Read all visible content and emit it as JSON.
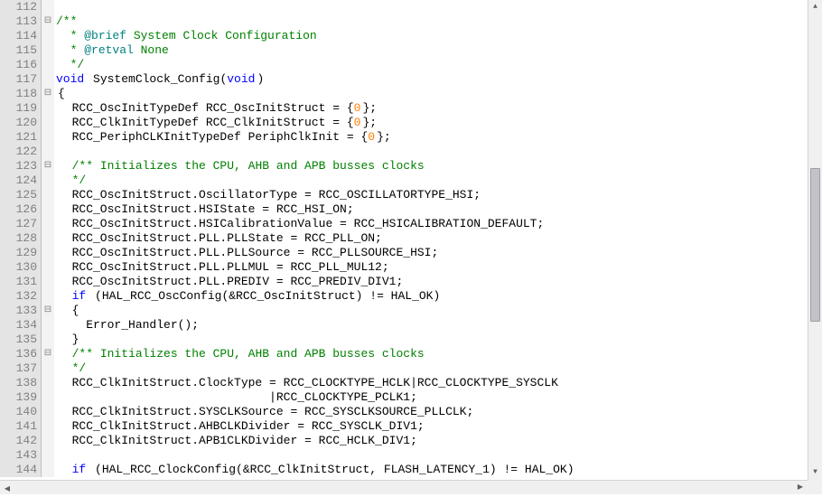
{
  "scroll": {
    "up": "▲",
    "down": "▼",
    "left": "◀",
    "right": "▶"
  },
  "lines": [
    {
      "n": "112",
      "fold": "",
      "seg": [
        {
          "c": "code",
          "t": ""
        }
      ]
    },
    {
      "n": "113",
      "fold": "⊟",
      "seg": [
        {
          "c": "doc",
          "t": "/**"
        }
      ]
    },
    {
      "n": "114",
      "fold": "",
      "seg": [
        {
          "c": "doc",
          "t": "  * "
        },
        {
          "c": "doctag",
          "t": "@brief"
        },
        {
          "c": "doc",
          "t": " System Clock Configuration"
        }
      ]
    },
    {
      "n": "115",
      "fold": "",
      "seg": [
        {
          "c": "doc",
          "t": "  * "
        },
        {
          "c": "doctag",
          "t": "@retval"
        },
        {
          "c": "doc",
          "t": " None"
        }
      ]
    },
    {
      "n": "116",
      "fold": "",
      "seg": [
        {
          "c": "doc",
          "t": "  */"
        }
      ]
    },
    {
      "n": "117",
      "fold": "",
      "seg": [
        {
          "c": "kw",
          "t": "void"
        },
        {
          "c": "code",
          "t": " SystemClock_Config("
        },
        {
          "c": "kw",
          "t": "void"
        },
        {
          "c": "code",
          "t": ")"
        }
      ]
    },
    {
      "n": "118",
      "fold": "⊟",
      "seg": [
        {
          "c": "code",
          "t": "{"
        }
      ]
    },
    {
      "n": "119",
      "fold": "",
      "seg": [
        {
          "c": "code",
          "t": "  RCC_OscInitTypeDef RCC_OscInitStruct = {"
        },
        {
          "c": "num",
          "t": "0"
        },
        {
          "c": "code",
          "t": "};"
        }
      ]
    },
    {
      "n": "120",
      "fold": "",
      "seg": [
        {
          "c": "code",
          "t": "  RCC_ClkInitTypeDef RCC_ClkInitStruct = {"
        },
        {
          "c": "num",
          "t": "0"
        },
        {
          "c": "code",
          "t": "};"
        }
      ]
    },
    {
      "n": "121",
      "fold": "",
      "seg": [
        {
          "c": "code",
          "t": "  RCC_PeriphCLKInitTypeDef PeriphClkInit = {"
        },
        {
          "c": "num",
          "t": "0"
        },
        {
          "c": "code",
          "t": "};"
        }
      ]
    },
    {
      "n": "122",
      "fold": "",
      "seg": [
        {
          "c": "code",
          "t": ""
        }
      ]
    },
    {
      "n": "123",
      "fold": "⊟",
      "seg": [
        {
          "c": "code",
          "t": "  "
        },
        {
          "c": "doc",
          "t": "/** Initializes the CPU, AHB and APB busses clocks"
        }
      ]
    },
    {
      "n": "124",
      "fold": "",
      "seg": [
        {
          "c": "code",
          "t": "  "
        },
        {
          "c": "doc",
          "t": "*/"
        }
      ]
    },
    {
      "n": "125",
      "fold": "",
      "seg": [
        {
          "c": "code",
          "t": "  RCC_OscInitStruct.OscillatorType = RCC_OSCILLATORTYPE_HSI;"
        }
      ]
    },
    {
      "n": "126",
      "fold": "",
      "seg": [
        {
          "c": "code",
          "t": "  RCC_OscInitStruct.HSIState = RCC_HSI_ON;"
        }
      ]
    },
    {
      "n": "127",
      "fold": "",
      "seg": [
        {
          "c": "code",
          "t": "  RCC_OscInitStruct.HSICalibrationValue = RCC_HSICALIBRATION_DEFAULT;"
        }
      ]
    },
    {
      "n": "128",
      "fold": "",
      "seg": [
        {
          "c": "code",
          "t": "  RCC_OscInitStruct.PLL.PLLState = RCC_PLL_ON;"
        }
      ]
    },
    {
      "n": "129",
      "fold": "",
      "seg": [
        {
          "c": "code",
          "t": "  RCC_OscInitStruct.PLL.PLLSource = RCC_PLLSOURCE_HSI;"
        }
      ]
    },
    {
      "n": "130",
      "fold": "",
      "seg": [
        {
          "c": "code",
          "t": "  RCC_OscInitStruct.PLL.PLLMUL = RCC_PLL_MUL12;"
        }
      ]
    },
    {
      "n": "131",
      "fold": "",
      "seg": [
        {
          "c": "code",
          "t": "  RCC_OscInitStruct.PLL.PREDIV = RCC_PREDIV_DIV1;"
        }
      ]
    },
    {
      "n": "132",
      "fold": "",
      "seg": [
        {
          "c": "code",
          "t": "  "
        },
        {
          "c": "kw",
          "t": "if"
        },
        {
          "c": "code",
          "t": " (HAL_RCC_OscConfig(&RCC_OscInitStruct) != HAL_OK)"
        }
      ]
    },
    {
      "n": "133",
      "fold": "⊟",
      "seg": [
        {
          "c": "code",
          "t": "  {"
        }
      ]
    },
    {
      "n": "134",
      "fold": "",
      "seg": [
        {
          "c": "code",
          "t": "    Error_Handler();"
        }
      ]
    },
    {
      "n": "135",
      "fold": "",
      "seg": [
        {
          "c": "code",
          "t": "  }"
        }
      ]
    },
    {
      "n": "136",
      "fold": "⊟",
      "seg": [
        {
          "c": "code",
          "t": "  "
        },
        {
          "c": "doc",
          "t": "/** Initializes the CPU, AHB and APB busses clocks"
        }
      ]
    },
    {
      "n": "137",
      "fold": "",
      "seg": [
        {
          "c": "code",
          "t": "  "
        },
        {
          "c": "doc",
          "t": "*/"
        }
      ]
    },
    {
      "n": "138",
      "fold": "",
      "seg": [
        {
          "c": "code",
          "t": "  RCC_ClkInitStruct.ClockType = RCC_CLOCKTYPE_HCLK|RCC_CLOCKTYPE_SYSCLK"
        }
      ]
    },
    {
      "n": "139",
      "fold": "",
      "seg": [
        {
          "c": "code",
          "t": "                              |RCC_CLOCKTYPE_PCLK1;"
        }
      ]
    },
    {
      "n": "140",
      "fold": "",
      "seg": [
        {
          "c": "code",
          "t": "  RCC_ClkInitStruct.SYSCLKSource = RCC_SYSCLKSOURCE_PLLCLK;"
        }
      ]
    },
    {
      "n": "141",
      "fold": "",
      "seg": [
        {
          "c": "code",
          "t": "  RCC_ClkInitStruct.AHBCLKDivider = RCC_SYSCLK_DIV1;"
        }
      ]
    },
    {
      "n": "142",
      "fold": "",
      "seg": [
        {
          "c": "code",
          "t": "  RCC_ClkInitStruct.APB1CLKDivider = RCC_HCLK_DIV1;"
        }
      ]
    },
    {
      "n": "143",
      "fold": "",
      "seg": [
        {
          "c": "code",
          "t": ""
        }
      ]
    },
    {
      "n": "144",
      "fold": "",
      "seg": [
        {
          "c": "code",
          "t": "  "
        },
        {
          "c": "kw",
          "t": "if"
        },
        {
          "c": "code",
          "t": " (HAL_RCC_ClockConfig(&RCC_ClkInitStruct, FLASH_LATENCY_1) != HAL_OK)"
        }
      ]
    }
  ]
}
